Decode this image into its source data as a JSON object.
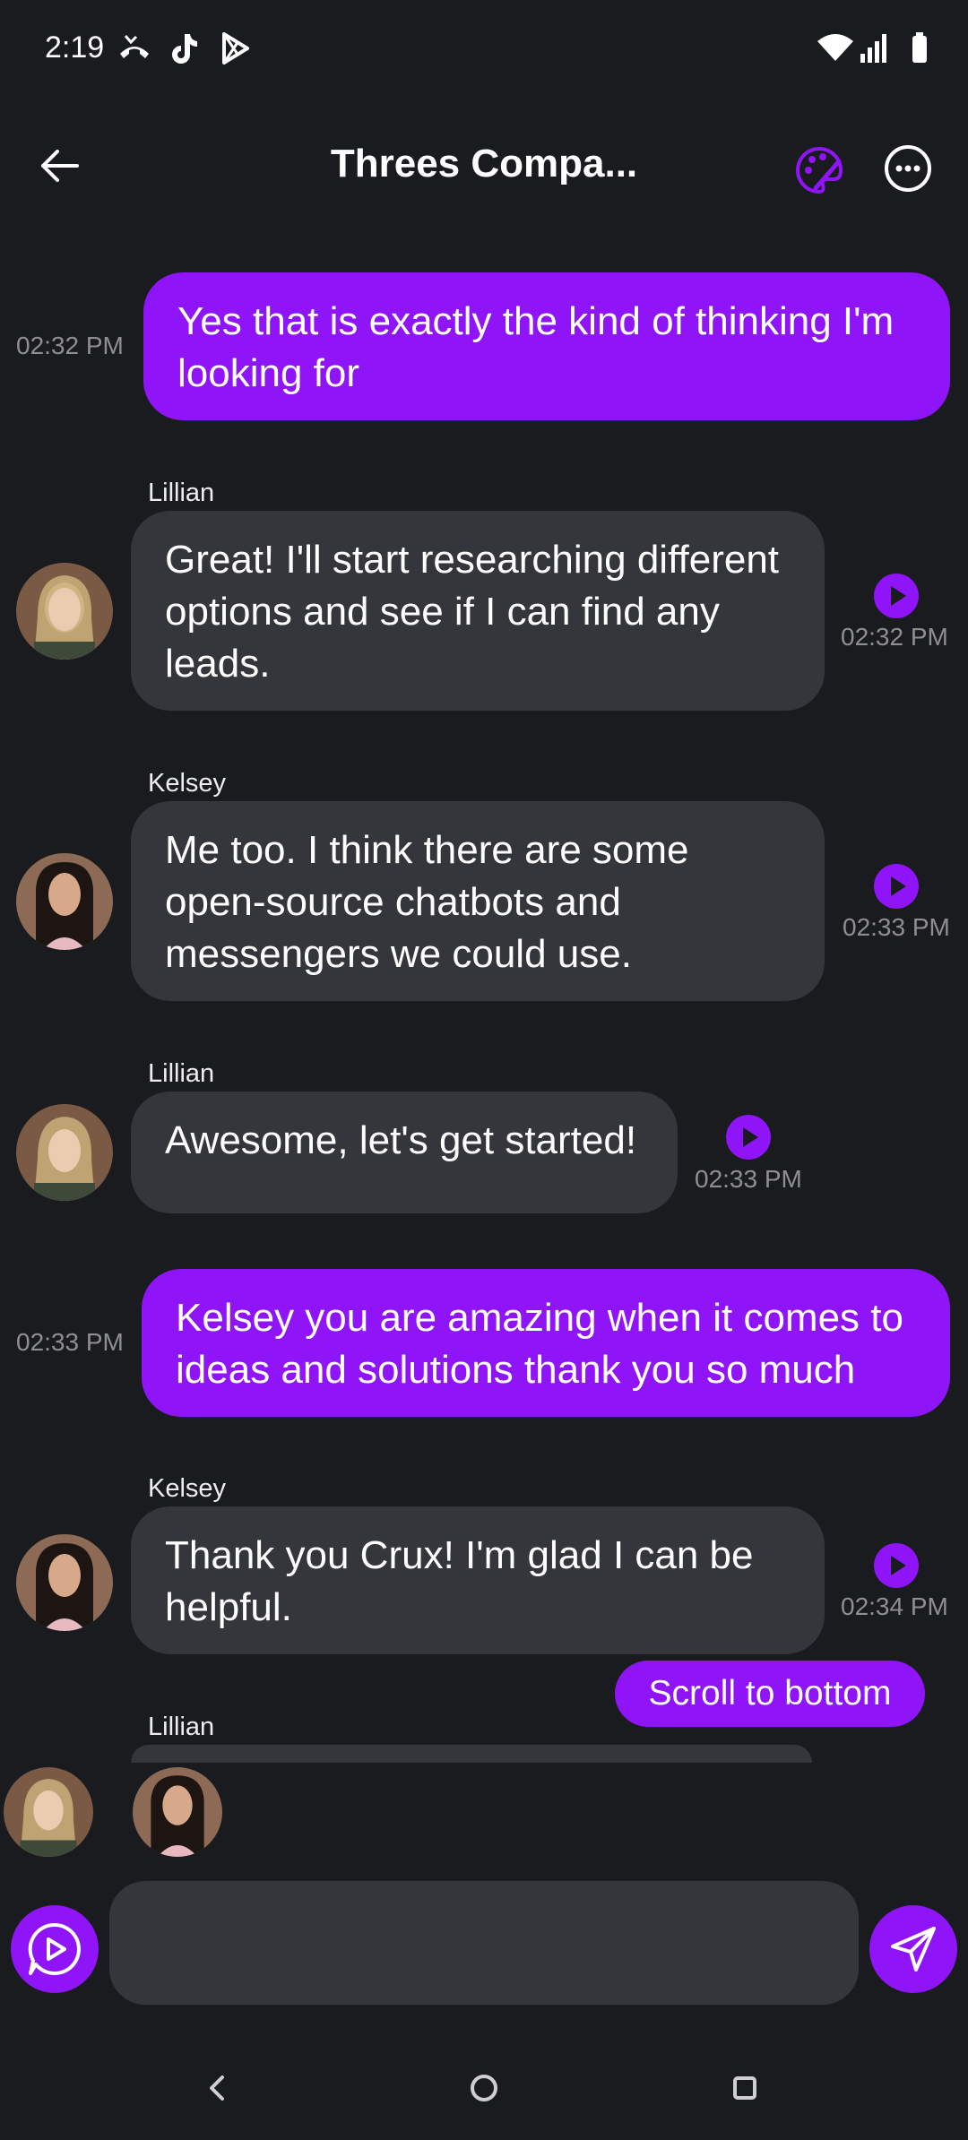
{
  "status_bar": {
    "time": "2:19"
  },
  "header": {
    "title": "Threes Compa..."
  },
  "messages": [
    {
      "text": "Yes that is exactly the kind of thinking I'm looking for",
      "time": "02:32 PM"
    },
    {
      "sender": "Lillian",
      "text": "Great! I'll start researching different options and see if I can find any leads.",
      "time": "02:32 PM"
    },
    {
      "sender": "Kelsey",
      "text": "Me too. I think there are some open-source chatbots and messengers we could use.",
      "time": "02:33 PM"
    },
    {
      "sender": "Lillian",
      "text": "Awesome, let's get started!",
      "time": "02:33 PM"
    },
    {
      "text": "Kelsey you are amazing when it comes to ideas and solutions thank you so much",
      "time": "02:33 PM"
    },
    {
      "sender": "Kelsey",
      "text": "Thank you Crux! I'm glad I can be helpful.",
      "time": "02:34 PM"
    },
    {
      "sender": "Lillian"
    }
  ],
  "scroll_button": {
    "label": "Scroll to bottom"
  },
  "composer": {
    "placeholder": ""
  },
  "colors": {
    "accent": "#8f14f7",
    "background": "#1a1b1f",
    "bubble_other": "#35363c"
  }
}
